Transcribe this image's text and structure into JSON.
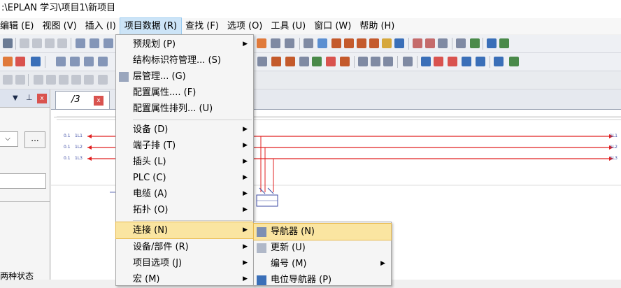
{
  "window": {
    "title": ":\\EPLAN 学习\\项目1\\新项目"
  },
  "menubar": {
    "items": [
      {
        "label": "编辑 (E)"
      },
      {
        "label": "视图 (V)"
      },
      {
        "label": "插入 (I)"
      },
      {
        "label": "项目数据 (R)"
      },
      {
        "label": "查找 (F)"
      },
      {
        "label": "选项 (O)"
      },
      {
        "label": "工具 (U)"
      },
      {
        "label": "窗口 (W)"
      },
      {
        "label": "帮助 (H)"
      }
    ]
  },
  "left_panel": {
    "combo_arrow": "⌵",
    "more_button": "...",
    "status_text": "两种状态"
  },
  "editor": {
    "tab_label": "/3",
    "tab_close": "x",
    "wires": {
      "left": [
        "1L1",
        "1L2",
        "1L3"
      ],
      "right": [
        "1L1",
        "1L2",
        "1L3"
      ],
      "ref": [
        "0.1",
        "0.1",
        "0.1"
      ]
    }
  },
  "project_data_menu": {
    "items": [
      {
        "label": "预规划 (P)",
        "submenu": true
      },
      {
        "label": "结构标识符管理... (S)",
        "submenu": false
      },
      {
        "label": "层管理... (G)",
        "submenu": false,
        "icon": "layer-icon"
      },
      {
        "label": "配置属性.... (F)",
        "submenu": false
      },
      {
        "label": "配置属性排列... (U)",
        "submenu": false
      },
      {
        "label": "设备 (D)",
        "submenu": true
      },
      {
        "label": "端子排 (T)",
        "submenu": true
      },
      {
        "label": "插头 (L)",
        "submenu": true
      },
      {
        "label": "PLC (C)",
        "submenu": true
      },
      {
        "label": "电缆 (A)",
        "submenu": true
      },
      {
        "label": "拓扑 (O)",
        "submenu": true
      },
      {
        "label": "连接 (N)",
        "submenu": true,
        "highlighted": true
      },
      {
        "label": "设备/部件 (R)",
        "submenu": true
      },
      {
        "label": "项目选项 (J)",
        "submenu": true
      },
      {
        "label": "宏 (M)",
        "submenu": true
      }
    ]
  },
  "connections_submenu": {
    "items": [
      {
        "label": "导航器 (N)",
        "highlighted": true,
        "icon": "navigator-icon"
      },
      {
        "label": "更新 (U)",
        "icon": "update-icon"
      },
      {
        "label": "编号 (M)",
        "submenu": true
      },
      {
        "label": "电位导航器 (P)",
        "icon": "potential-navigator-icon"
      }
    ]
  },
  "colors": {
    "menu_highlight": "#fae5a1",
    "wire_red": "#e02020",
    "close_red": "#d9534f",
    "menubar_active": "#cce4f7"
  }
}
